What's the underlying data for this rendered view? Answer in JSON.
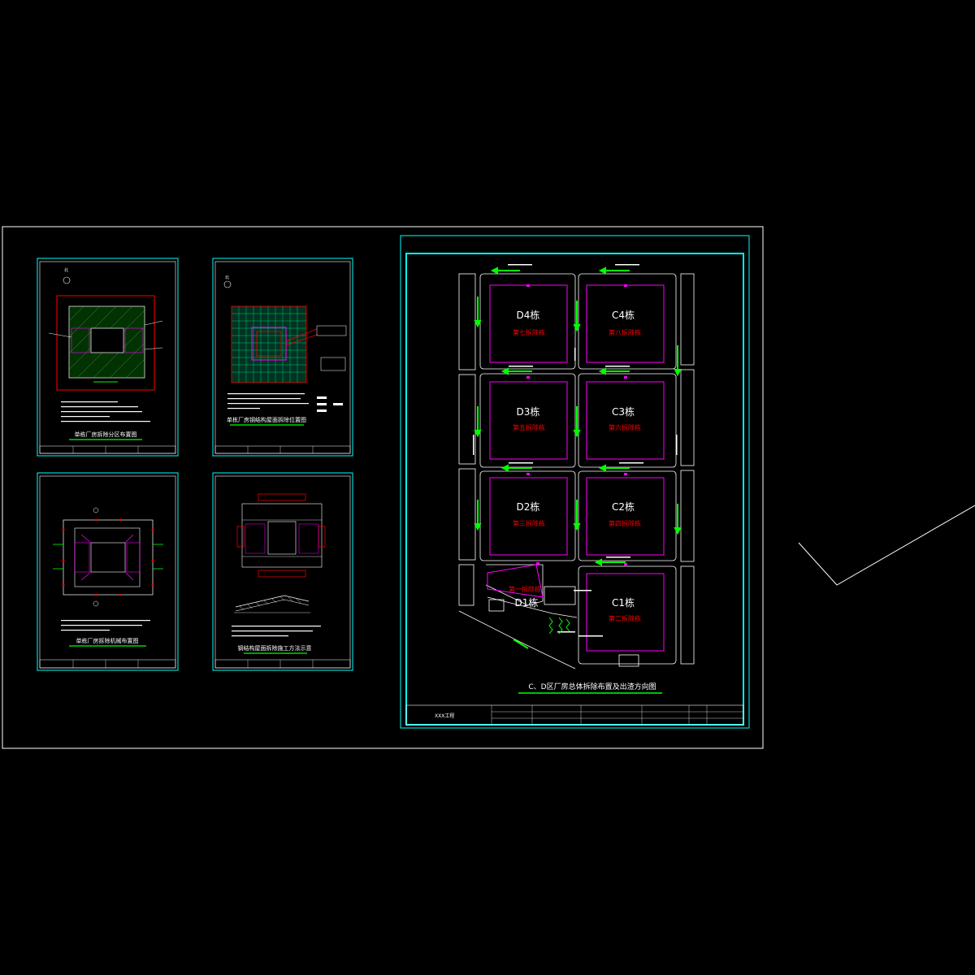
{
  "colors": {
    "background": "#000000",
    "frame": "#ffffff",
    "sheet_border": "#00ffff",
    "building_outline": "#ff00ff",
    "building_label": "#ffffff",
    "stage_label": "#ff0000",
    "arrow": "#00ff00",
    "title_underline": "#00ff00",
    "road_line": "#ffffff",
    "hatch": "#00ff00"
  },
  "main_sheet": {
    "title": "C、D区厂房总体拆除布置及出渣方向图",
    "title_block_org": "XXX工程",
    "buildings": [
      {
        "id": "D4",
        "label": "D4栋",
        "stage": "第七拆除栋"
      },
      {
        "id": "C4",
        "label": "C4栋",
        "stage": "第八拆除栋"
      },
      {
        "id": "D3",
        "label": "D3栋",
        "stage": "第五拆除栋"
      },
      {
        "id": "C3",
        "label": "C3栋",
        "stage": "第六拆除栋"
      },
      {
        "id": "D2",
        "label": "D2栋",
        "stage": "第三拆除栋"
      },
      {
        "id": "C2",
        "label": "C2栋",
        "stage": "第四拆除栋"
      },
      {
        "id": "D1",
        "label": "D1栋",
        "stage": "第一拆除栋"
      },
      {
        "id": "C1",
        "label": "C1栋",
        "stage": "第二拆除栋"
      }
    ]
  },
  "small_sheets": [
    {
      "id": "sheet-1",
      "title": "单栋厂房拆除分区布置图"
    },
    {
      "id": "sheet-2",
      "title": "单栋厂房钢结构屋面拆除位置图"
    },
    {
      "id": "sheet-3",
      "title": "单栋厂房拆除机械布置图"
    },
    {
      "id": "sheet-4",
      "title": "钢结构屋面拆除施工方法示意"
    }
  ]
}
